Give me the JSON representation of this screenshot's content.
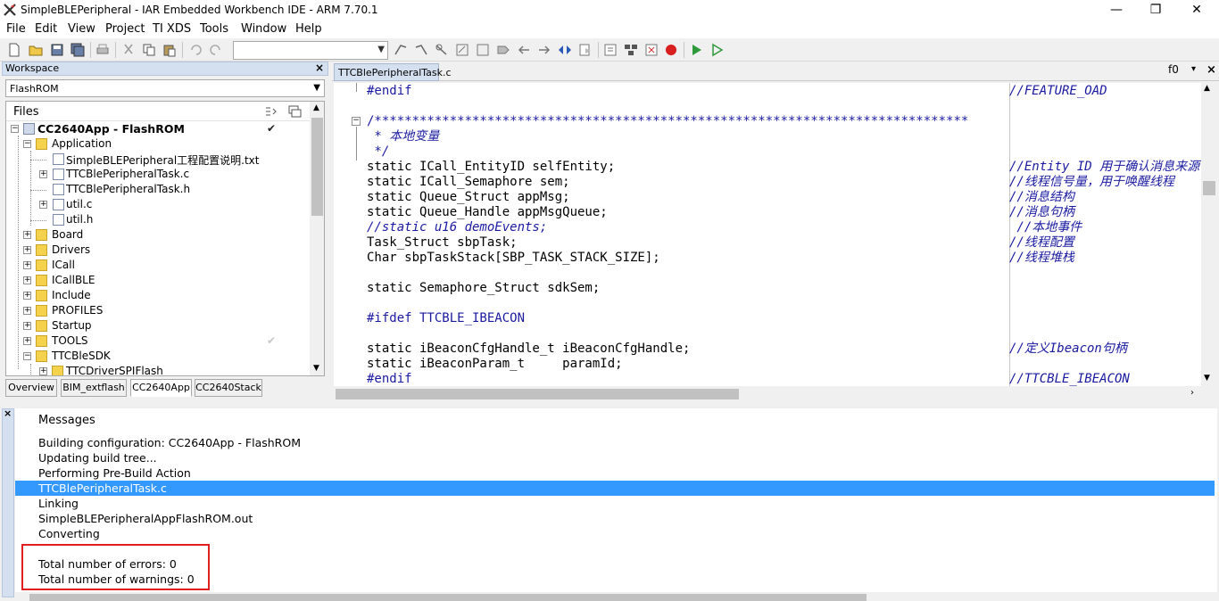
{
  "window": {
    "title": "SimpleBLEPeripheral - IAR Embedded Workbench IDE - ARM 7.70.1",
    "minimize": "—",
    "restore": "❐",
    "close": "✕"
  },
  "menu": [
    "File",
    "Edit",
    "View",
    "Project",
    "TI XDS",
    "Tools",
    "Window",
    "Help"
  ],
  "toolbar": {
    "combo_value": ""
  },
  "workspace": {
    "title": "Workspace",
    "close": "×",
    "config": "FlashROM",
    "files_header": "Files",
    "rows": [
      {
        "label": "CC2640App - FlashROM",
        "exp": "−",
        "check": "✔"
      },
      {
        "label": "Application",
        "exp": "−"
      },
      {
        "label": "SimpleBLEPeripheral工程配置说明.txt"
      },
      {
        "label": "TTCBlePeripheralTask.c",
        "exp": "+"
      },
      {
        "label": "TTCBlePeripheralTask.h"
      },
      {
        "label": "util.c",
        "exp": "+"
      },
      {
        "label": "util.h"
      },
      {
        "label": "Board",
        "exp": "+"
      },
      {
        "label": "Drivers",
        "exp": "+"
      },
      {
        "label": "ICall",
        "exp": "+"
      },
      {
        "label": "ICallBLE",
        "exp": "+"
      },
      {
        "label": "Include",
        "exp": "+"
      },
      {
        "label": "PROFILES",
        "exp": "+"
      },
      {
        "label": "Startup",
        "exp": "+"
      },
      {
        "label": "TOOLS",
        "exp": "+",
        "check": "✔"
      },
      {
        "label": "TTCBleSDK",
        "exp": "−"
      },
      {
        "label": "TTCDriverSPIFlash",
        "exp": "+"
      }
    ],
    "tabs": [
      "Overview",
      "BIM_extflash",
      "CC2640App",
      "CC2640Stack"
    ],
    "active_tab": "CC2640App"
  },
  "editor": {
    "tab": "TTCBlePeripheralTask.c",
    "func": "f0",
    "dd": "▾",
    "close": "×",
    "lines": [
      {
        "code": "#endif",
        "comment": "//FEATURE_OAD"
      },
      {
        "code": "",
        "comment": ""
      },
      {
        "code": "/*******************************************************************************",
        "comment": ""
      },
      {
        "code": " * 本地变量",
        "comment": ""
      },
      {
        "code": " */",
        "comment": ""
      },
      {
        "code": "static ICall_EntityID selfEntity;",
        "comment": "//Entity ID 用于确认消息来源"
      },
      {
        "code": "static ICall_Semaphore sem;",
        "comment": "//线程信号量，用于唤醒线程"
      },
      {
        "code": "static Queue_Struct appMsg;",
        "comment": "//消息结构"
      },
      {
        "code": "static Queue_Handle appMsgQueue;",
        "comment": "//消息句柄"
      },
      {
        "code": "//static u16 demoEvents;",
        "comment": " //本地事件"
      },
      {
        "code": "Task_Struct sbpTask;",
        "comment": "//线程配置"
      },
      {
        "code": "Char sbpTaskStack[SBP_TASK_STACK_SIZE];",
        "comment": "//线程堆栈"
      },
      {
        "code": "",
        "comment": ""
      },
      {
        "code": "static Semaphore_Struct sdkSem;",
        "comment": ""
      },
      {
        "code": "",
        "comment": ""
      },
      {
        "code": "#ifdef TTCBLE_IBEACON",
        "comment": ""
      },
      {
        "code": "",
        "comment": ""
      },
      {
        "code": "static iBeaconCfgHandle_t iBeaconCfgHandle;",
        "comment": "//定义Ibeacon句柄"
      },
      {
        "code": "static iBeaconParam_t     paramId;",
        "comment": ""
      },
      {
        "code": "#endif",
        "comment": "//TTCBLE_IBEACON"
      }
    ]
  },
  "messages": {
    "close": "×",
    "header": "Messages",
    "lines": [
      "Building configuration: CC2640App - FlashROM",
      "Updating build tree...",
      "Performing Pre-Build Action",
      "TTCBlePeripheralTask.c",
      "Linking",
      "SimpleBLEPeripheralAppFlashROM.out",
      "Converting",
      "",
      "Total number of errors: 0",
      "Total number of warnings: 0"
    ],
    "selected_index": 3
  }
}
